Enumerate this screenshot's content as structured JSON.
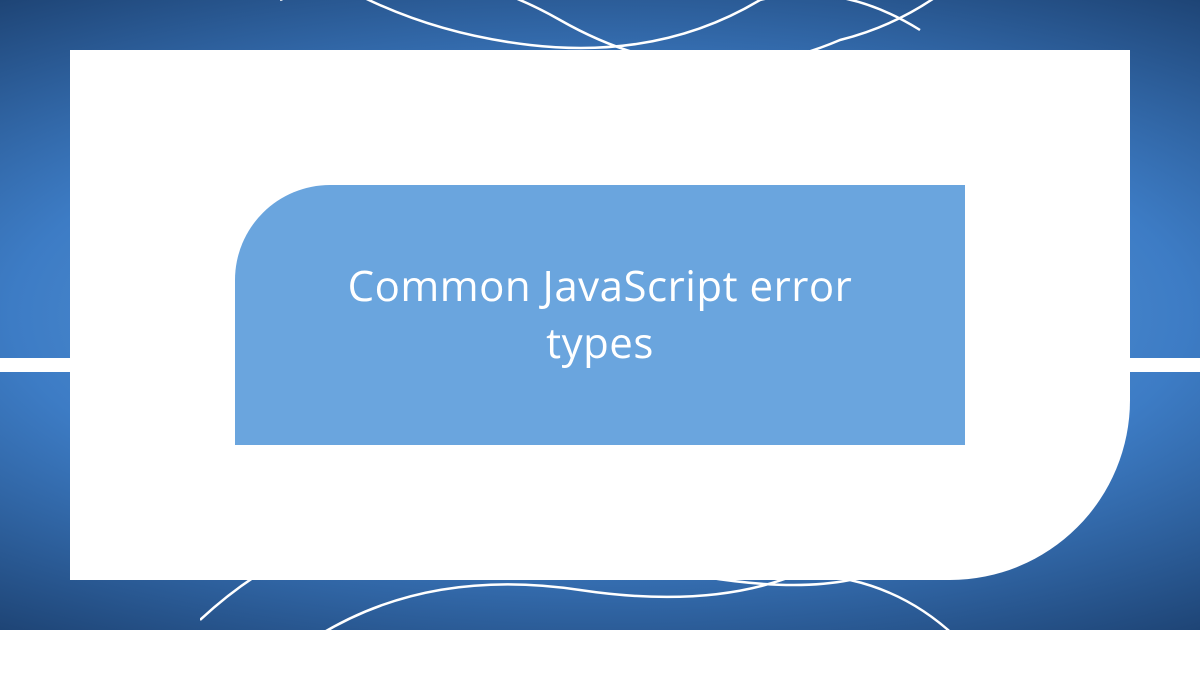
{
  "title": "Common JavaScript error types"
}
